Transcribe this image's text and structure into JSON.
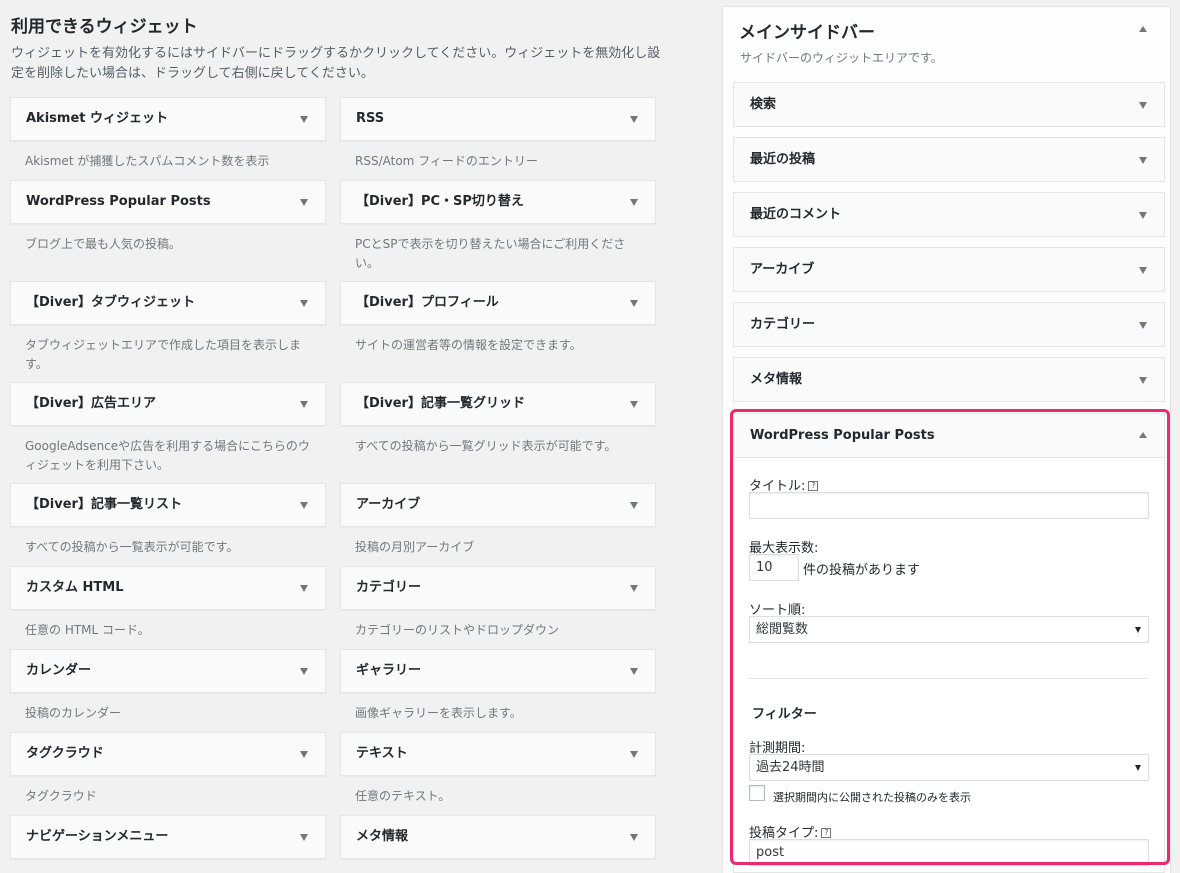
{
  "available": {
    "title": "利用できるウィジェット",
    "description": "ウィジェットを有効化するにはサイドバーにドラッグするかクリックしてください。ウィジェットを無効化し設定を削除したい場合は、ドラッグして右側に戻してください。",
    "left_column": [
      {
        "title": "Akismet ウィジェット",
        "desc": "Akismet が捕獲したスパムコメント数を表示"
      },
      {
        "title": "WordPress Popular Posts",
        "desc": "ブログ上で最も人気の投稿。"
      },
      {
        "title": "【Diver】タブウィジェット",
        "desc": "タブウィジェットエリアで作成した項目を表示します。"
      },
      {
        "title": "【Diver】広告エリア",
        "desc": "GoogleAdsenceや広告を利用する場合にこちらのウィジェットを利用下さい。"
      },
      {
        "title": "【Diver】記事一覧リスト",
        "desc": "すべての投稿から一覧表示が可能です。"
      },
      {
        "title": "カスタム HTML",
        "desc": "任意の HTML コード。"
      },
      {
        "title": "カレンダー",
        "desc": "投稿のカレンダー"
      },
      {
        "title": "タグクラウド",
        "desc": "タグクラウド"
      },
      {
        "title": "ナビゲーションメニュー",
        "desc": ""
      }
    ],
    "right_column": [
      {
        "title": "RSS",
        "desc": "RSS/Atom フィードのエントリー"
      },
      {
        "title": "【Diver】PC・SP切り替え",
        "desc": "PCとSPで表示を切り替えたい場合にご利用ください。"
      },
      {
        "title": "【Diver】プロフィール",
        "desc": "サイトの運営者等の情報を設定できます。"
      },
      {
        "title": "【Diver】記事一覧グリッド",
        "desc": "すべての投稿から一覧グリッド表示が可能です。"
      },
      {
        "title": "アーカイブ",
        "desc": "投稿の月別アーカイブ"
      },
      {
        "title": "カテゴリー",
        "desc": "カテゴリーのリストやドロップダウン"
      },
      {
        "title": "ギャラリー",
        "desc": "画像ギャラリーを表示します。"
      },
      {
        "title": "テキスト",
        "desc": "任意のテキスト。"
      },
      {
        "title": "メタ情報",
        "desc": ""
      }
    ]
  },
  "sidebar": {
    "title": "メインサイドバー",
    "description": "サイドバーのウィジットエリアです。",
    "widgets": [
      "検索",
      "最近の投稿",
      "最近のコメント",
      "アーカイブ",
      "カテゴリー",
      "メタ情報"
    ],
    "expanded": {
      "title": "WordPress Popular Posts",
      "title_label": "タイトル:",
      "title_value": "",
      "help": "?",
      "max_label": "最大表示数:",
      "max_value": "10",
      "max_suffix": "件の投稿があります",
      "sort_label": "ソート順:",
      "sort_value": "総閲覧数",
      "filter_heading": "フィルター",
      "period_label": "計測期間:",
      "period_value": "過去24時間",
      "period_checkbox_label": "選択期間内に公開された投稿のみを表示",
      "post_type_label": "投稿タイプ:",
      "post_type_value": "post"
    }
  },
  "colors": {
    "highlight": "#ea2a6f",
    "background": "#f1f1f1"
  }
}
